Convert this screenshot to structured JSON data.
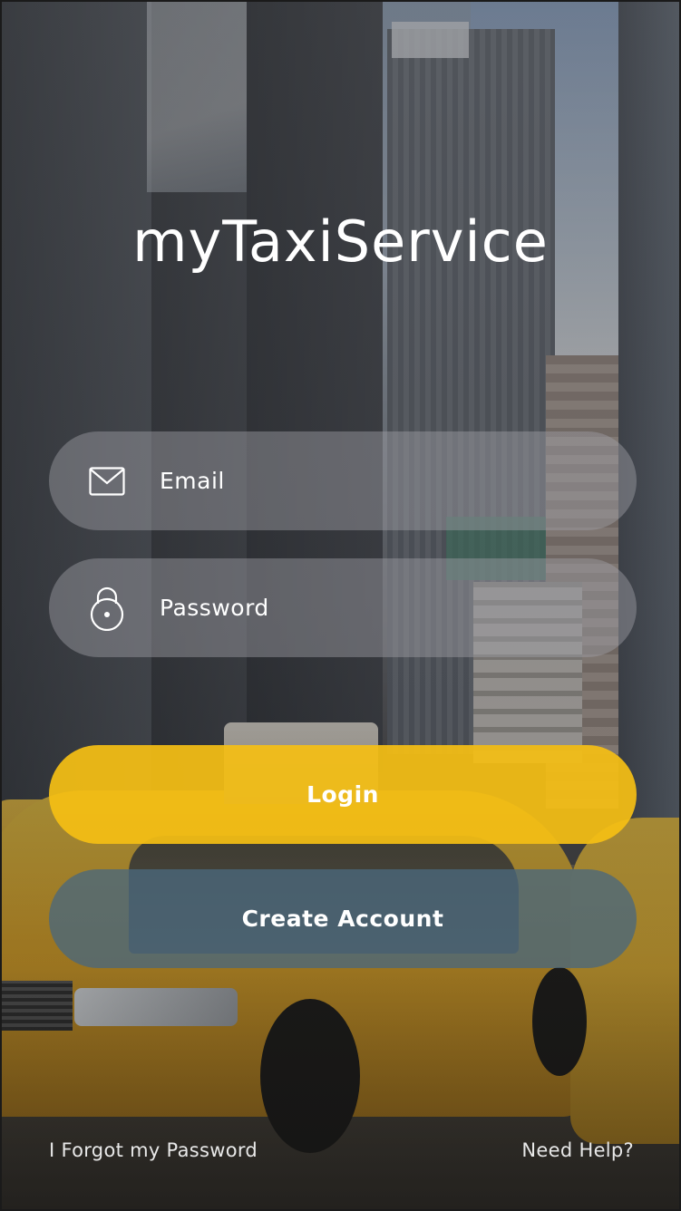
{
  "app": {
    "title": "myTaxiService"
  },
  "login_form": {
    "email": {
      "placeholder": "Email",
      "value": "",
      "icon": "envelope-icon"
    },
    "password": {
      "placeholder": "Password",
      "value": "",
      "icon": "padlock-icon"
    }
  },
  "actions": {
    "login_label": "Login",
    "create_account_label": "Create Account"
  },
  "footer": {
    "forgot_password": "I Forgot my Password",
    "need_help": "Need Help?"
  },
  "colors": {
    "login_button": "#f4be14",
    "create_account_button": "#4a687c",
    "text": "#ffffff"
  }
}
